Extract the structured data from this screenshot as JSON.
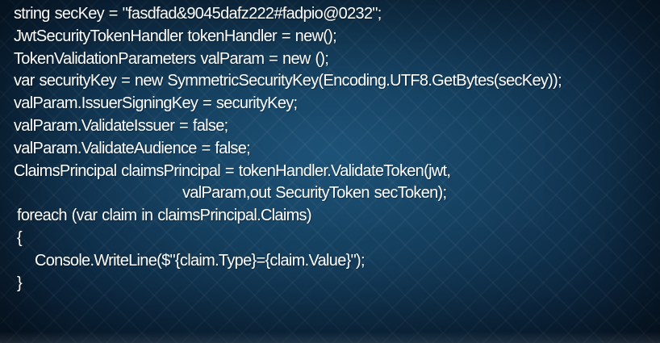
{
  "code_lines": [
    {
      "text": "string secKey = \"fasdfad&9045dafz222#fadpio@0232\";",
      "indent": 0
    },
    {
      "text": "JwtSecurityTokenHandler tokenHandler = new();",
      "indent": 0
    },
    {
      "text": "TokenValidationParameters valParam = new ();",
      "indent": 0
    },
    {
      "text": "var securityKey = new SymmetricSecurityKey(Encoding.UTF8.GetBytes(secKey));",
      "indent": 0
    },
    {
      "text": "valParam.IssuerSigningKey = securityKey;",
      "indent": 0
    },
    {
      "text": "valParam.ValidateIssuer = false;",
      "indent": 0
    },
    {
      "text": "valParam.ValidateAudience = false;",
      "indent": 0
    },
    {
      "text": "ClaimsPrincipal claimsPrincipal = tokenHandler.ValidateToken(jwt,",
      "indent": 0
    },
    {
      "text": "valParam,out SecurityToken secToken);",
      "indent": 1
    },
    {
      "text": "foreach (var claim in claimsPrincipal.Claims)",
      "indent": 2
    },
    {
      "text": "{",
      "indent": 2
    },
    {
      "text": "Console.WriteLine($\"{claim.Type}={claim.Value}\");",
      "indent": 3
    },
    {
      "text": "}",
      "indent": 2
    }
  ],
  "colors": {
    "text": "#ffffff",
    "background": "#153f5e"
  }
}
